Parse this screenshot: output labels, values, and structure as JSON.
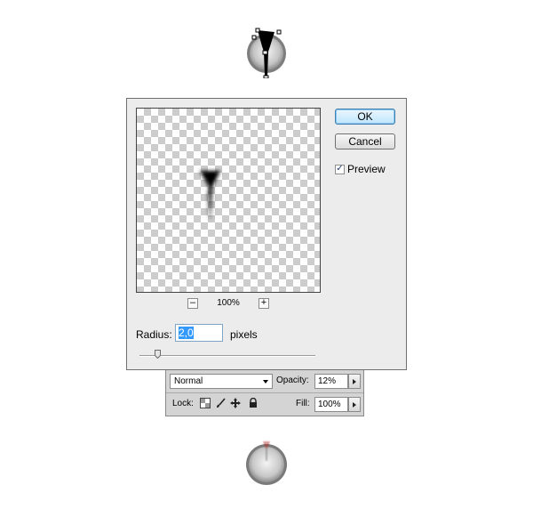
{
  "dialog": {
    "ok_label": "OK",
    "cancel_label": "Cancel",
    "preview_label": "Preview",
    "preview_checked": true,
    "zoom_value": "100%",
    "zoom_out_symbol": "–",
    "zoom_in_symbol": "+",
    "radius_label": "Radius:",
    "radius_value": "2,0",
    "radius_unit": "pixels"
  },
  "layers": {
    "blend_mode": "Normal",
    "opacity_label": "Opacity:",
    "opacity_value": "12%",
    "lock_label": "Lock:",
    "fill_label": "Fill:",
    "fill_value": "100%",
    "lock_icons": [
      "lock-transparent-icon",
      "lock-brush-icon",
      "lock-move-icon",
      "lock-all-icon"
    ]
  },
  "colors": {
    "accent_selection": "#3399ff",
    "dialog_bg": "#ececec",
    "ok_border": "#3c7fb1"
  }
}
